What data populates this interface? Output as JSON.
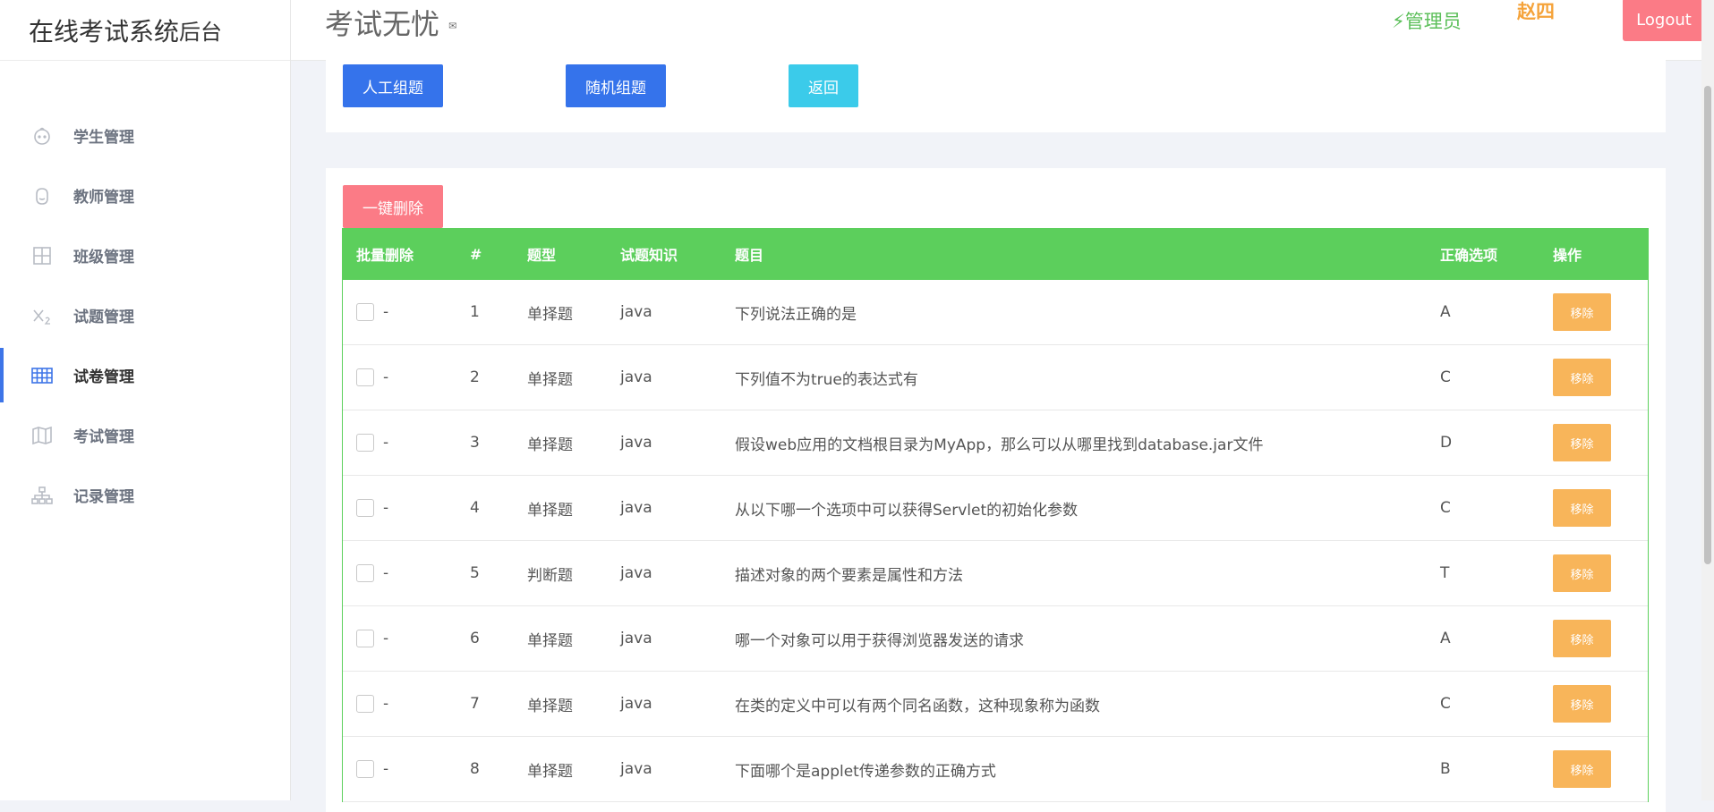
{
  "sidebar": {
    "brand_main": "在线考试系统",
    "brand_suffix": "后台",
    "items": [
      {
        "label": "学生管理",
        "icon": "face-icon"
      },
      {
        "label": "教师管理",
        "icon": "smile-icon"
      },
      {
        "label": "班级管理",
        "icon": "grid-icon"
      },
      {
        "label": "试题管理",
        "icon": "subscript-icon"
      },
      {
        "label": "试卷管理",
        "icon": "table-icon",
        "active": true
      },
      {
        "label": "考试管理",
        "icon": "map-icon"
      },
      {
        "label": "记录管理",
        "icon": "sitemap-icon"
      }
    ]
  },
  "header": {
    "site_title": "考试无忧",
    "role": "管理员",
    "username": "赵四",
    "logout_label": "Logout"
  },
  "toolbar": {
    "manual_label": "人工组题",
    "random_label": "随机组题",
    "back_label": "返回"
  },
  "table": {
    "delete_all_label": "一键删除",
    "headers": {
      "batch": "批量删除",
      "num": "#",
      "type": "题型",
      "knowledge": "试题知识",
      "question": "题目",
      "answer": "正确选项",
      "action": "操作"
    },
    "rows": [
      {
        "dash": "-",
        "num": "1",
        "type": "单择题",
        "knowledge": "java",
        "question": "下列说法正确的是",
        "answer": "A",
        "action": "移除"
      },
      {
        "dash": "-",
        "num": "2",
        "type": "单择题",
        "knowledge": "java",
        "question": "下列值不为true的表达式有",
        "answer": "C",
        "action": "移除"
      },
      {
        "dash": "-",
        "num": "3",
        "type": "单择题",
        "knowledge": "java",
        "question": "假设web应用的文档根目录为MyApp，那么可以从哪里找到database.jar文件",
        "answer": "D",
        "action": "移除"
      },
      {
        "dash": "-",
        "num": "4",
        "type": "单择题",
        "knowledge": "java",
        "question": "从以下哪一个选项中可以获得Servlet的初始化参数",
        "answer": "C",
        "action": "移除"
      },
      {
        "dash": "-",
        "num": "5",
        "type": "判断题",
        "knowledge": "java",
        "question": "描述对象的两个要素是属性和方法",
        "answer": "T",
        "action": "移除"
      },
      {
        "dash": "-",
        "num": "6",
        "type": "单择题",
        "knowledge": "java",
        "question": "哪一个对象可以用于获得浏览器发送的请求",
        "answer": "A",
        "action": "移除"
      },
      {
        "dash": "-",
        "num": "7",
        "type": "单择题",
        "knowledge": "java",
        "question": "在类的定义中可以有两个同名函数，这种现象称为函数",
        "answer": "C",
        "action": "移除"
      },
      {
        "dash": "-",
        "num": "8",
        "type": "单择题",
        "knowledge": "java",
        "question": "下面哪个是applet传递参数的正确方式",
        "answer": "B",
        "action": "移除"
      }
    ]
  },
  "colors": {
    "primary": "#3573eb",
    "table_header": "#5ccf5c",
    "danger": "#fb7b86",
    "warning": "#f8b55a",
    "info": "#3bcbea"
  }
}
